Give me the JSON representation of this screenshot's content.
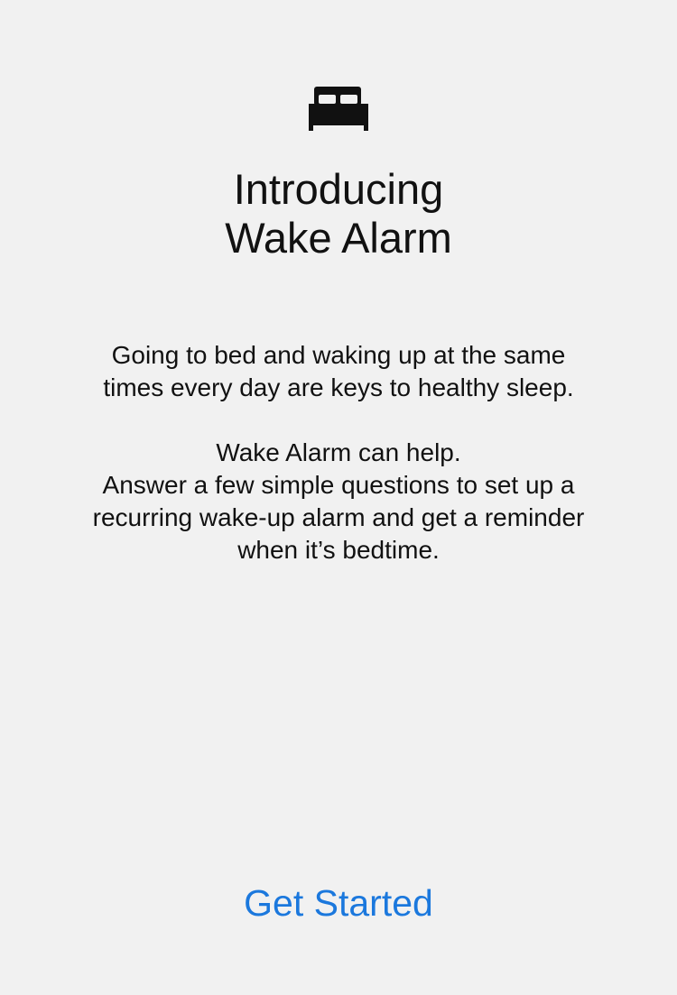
{
  "icon": "bed-icon",
  "title": {
    "line1": "Introducing",
    "line2": "Wake Alarm"
  },
  "description": {
    "paragraph1": "Going to bed and waking up at the same times every day are keys to healthy sleep.",
    "paragraph2_line1": "Wake Alarm can help.",
    "paragraph2_line2": "Answer a few simple questions to set up a recurring wake-up alarm and get a reminder when it’s bedtime."
  },
  "actions": {
    "get_started_label": "Get Started"
  },
  "colors": {
    "background": "#f1f1f1",
    "text": "#111111",
    "accent": "#1b78dd"
  }
}
